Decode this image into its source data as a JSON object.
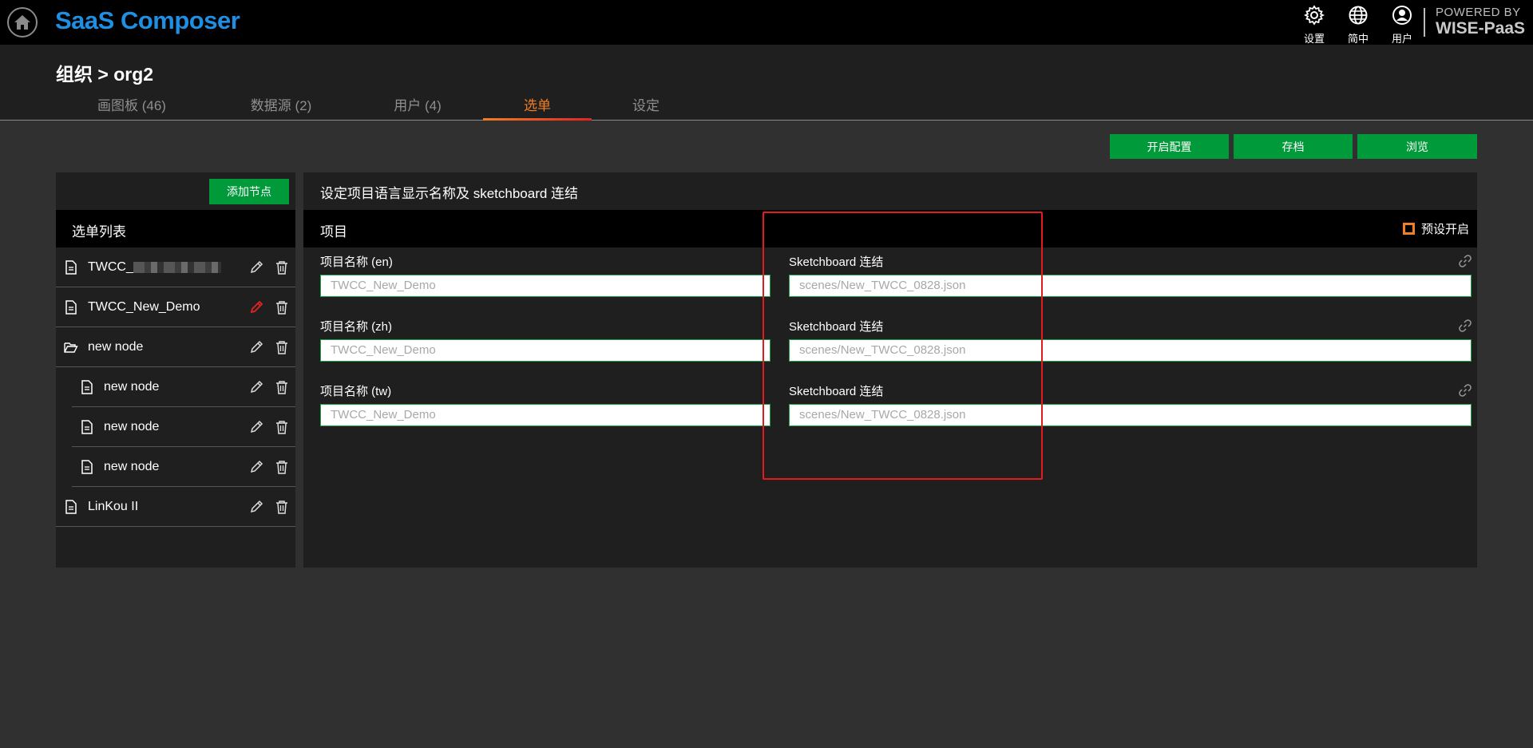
{
  "app": {
    "title": "SaaS Composer"
  },
  "topbar": {
    "settings_label": "设置",
    "language_label": "简中",
    "user_label": "用户",
    "powered_line1": "POWERED BY",
    "powered_line2": "WISE-PaaS"
  },
  "page": {
    "breadcrumb": "组织 > org2"
  },
  "tabs": [
    {
      "label": "画图板 (46)"
    },
    {
      "label": "数据源 (2)"
    },
    {
      "label": "用户 (4)"
    },
    {
      "label": "选单",
      "active": true
    },
    {
      "label": "设定"
    }
  ],
  "actions": {
    "enable_config": "开启配置",
    "save": "存档",
    "browse": "浏览"
  },
  "menu_panel": {
    "add_node_label": "添加节点",
    "list_title": "选单列表",
    "items": [
      {
        "label": "TWCC_",
        "redacted": true,
        "icon": "document-icon",
        "level": 0
      },
      {
        "label": "TWCC_New_Demo",
        "icon": "document-icon",
        "level": 0,
        "editing": true
      },
      {
        "label": "new node",
        "icon": "folder-open-icon",
        "level": 0
      },
      {
        "label": "new node",
        "icon": "document-icon",
        "level": 1
      },
      {
        "label": "new node",
        "icon": "document-icon",
        "level": 1
      },
      {
        "label": "new node",
        "icon": "document-icon",
        "level": 1
      },
      {
        "label": "LinKou II",
        "icon": "document-icon",
        "level": 0
      }
    ]
  },
  "detail_panel": {
    "title": "设定项目语言显示名称及 sketchboard 连结",
    "column_label": "项目",
    "preset_label": "预设开启",
    "rows": [
      {
        "name_label": "项目名称 (en)",
        "name_placeholder": "TWCC_New_Demo",
        "link_label": "Sketchboard 连结",
        "link_placeholder": "scenes/New_TWCC_0828.json"
      },
      {
        "name_label": "项目名称 (zh)",
        "name_placeholder": "TWCC_New_Demo",
        "link_label": "Sketchboard 连结",
        "link_placeholder": "scenes/New_TWCC_0828.json"
      },
      {
        "name_label": "项目名称 (tw)",
        "name_placeholder": "TWCC_New_Demo",
        "link_label": "Sketchboard 连结",
        "link_placeholder": "scenes/New_TWCC_0828.json"
      }
    ]
  },
  "colors": {
    "accent_green": "#009a3a",
    "active_tab": "#f07f25",
    "brand_blue": "#1f8fe3",
    "highlight_red": "#e51b1b"
  }
}
